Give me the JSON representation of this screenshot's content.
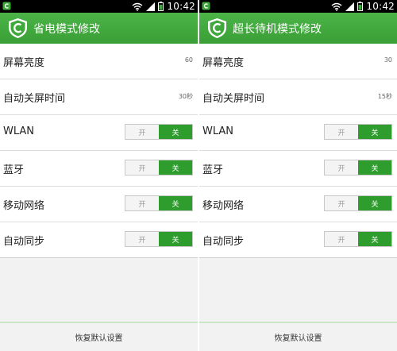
{
  "status_bar": {
    "time": "10:42"
  },
  "colors": {
    "accent": "#3ea83a",
    "toggle_on": "#2e9d2e"
  },
  "panels": [
    {
      "title": "省电模式修改",
      "rows": [
        {
          "label": "屏幕亮度",
          "value": "60"
        },
        {
          "label": "自动关屏时间",
          "value": "30秒"
        },
        {
          "label": "WLAN",
          "off": "开",
          "on": "关"
        },
        {
          "label": "蓝牙",
          "off": "开",
          "on": "关"
        },
        {
          "label": "移动网络",
          "off": "开",
          "on": "关"
        },
        {
          "label": "自动同步",
          "off": "开",
          "on": "关"
        }
      ],
      "footer_button": "恢复默认设置"
    },
    {
      "title": "超长待机模式修改",
      "rows": [
        {
          "label": "屏幕亮度",
          "value": "30"
        },
        {
          "label": "自动关屏时间",
          "value": "15秒"
        },
        {
          "label": "WLAN",
          "off": "开",
          "on": "关"
        },
        {
          "label": "蓝牙",
          "off": "开",
          "on": "关"
        },
        {
          "label": "移动网络",
          "off": "开",
          "on": "关"
        },
        {
          "label": "自动同步",
          "off": "开",
          "on": "关"
        }
      ],
      "footer_button": "恢复默认设置"
    }
  ]
}
